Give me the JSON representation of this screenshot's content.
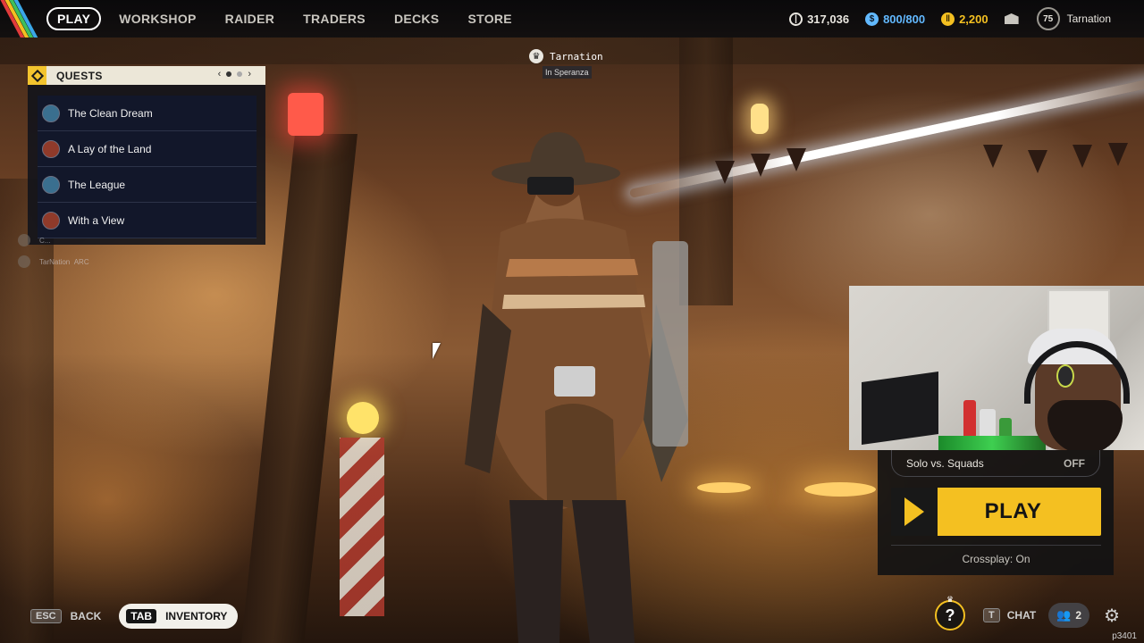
{
  "nav": {
    "items": [
      "PLAY",
      "WORKSHOP",
      "RAIDER",
      "TRADERS",
      "DECKS",
      "STORE"
    ],
    "active": "PLAY"
  },
  "currencies": [
    {
      "icon": "coins-icon",
      "value": "317,036",
      "color": "#e9e6df"
    },
    {
      "icon": "raider-token-icon",
      "value": "800/800",
      "color": "#62b9ff"
    },
    {
      "icon": "cred-icon",
      "value": "2,200",
      "color": "#f4c021"
    }
  ],
  "player": {
    "level": "75",
    "name": "Tarnation"
  },
  "player_tag": {
    "name": "Tarnation",
    "location": "In Speranza"
  },
  "quests": {
    "title": "QUESTS",
    "pager": {
      "prev": "‹",
      "next": "›"
    },
    "items": [
      {
        "label": "The Clean Dream",
        "icon_color": "#3a6f8f"
      },
      {
        "label": "A Lay of the Land",
        "icon_color": "#8f3a2a"
      },
      {
        "label": "The League",
        "icon_color": "#3a6f8f"
      },
      {
        "label": "With a View",
        "icon_color": "#8f3a2a"
      }
    ]
  },
  "party_ghost": {
    "row1": "C...",
    "row2_name": "TarNation",
    "row2_tag": "ARC"
  },
  "play_panel": {
    "solo_label": "Solo vs. Squads",
    "solo_value": "OFF",
    "play_label": "PLAY",
    "crossplay": "Crossplay: On"
  },
  "bottom": {
    "esc_key": "ESC",
    "back_label": "BACK",
    "tab_key": "TAB",
    "inventory_label": "INVENTORY",
    "help_label": "?",
    "chat_key": "T",
    "chat_label": "CHAT",
    "friends_count": "2",
    "build": "p3401"
  },
  "colors": {
    "accent": "#f4c021",
    "panel": "#12172a"
  }
}
